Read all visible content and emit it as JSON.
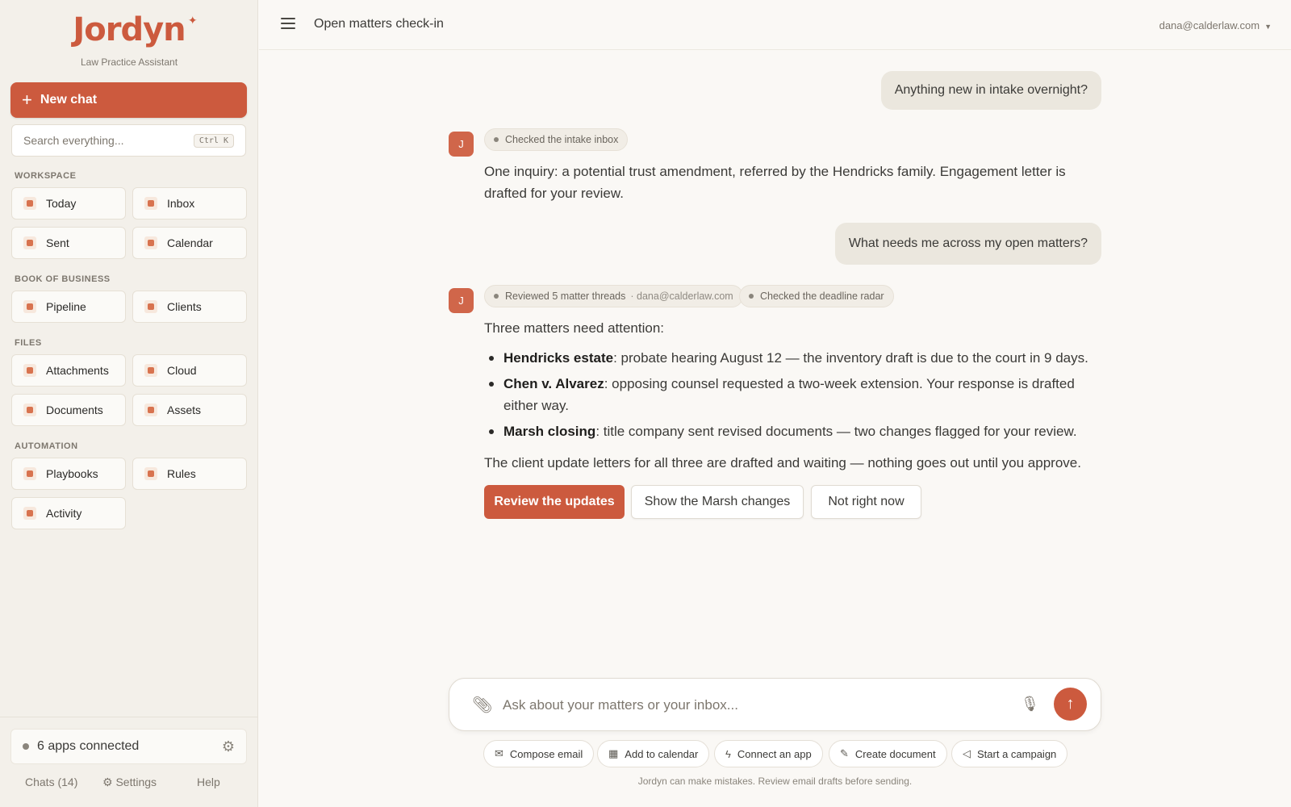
{
  "sidebar": {
    "logo": "Jordyn",
    "tagline": "Law Practice Assistant",
    "new_chat_label": "New chat",
    "search_placeholder": "Search everything...",
    "search_shortcut": "Ctrl K",
    "sections": {
      "workspace": "WORKSPACE",
      "book": "BOOK OF BUSINESS",
      "files": "FILES",
      "automation": "AUTOMATION"
    },
    "items": {
      "today": "Today",
      "inbox": "Inbox",
      "sent": "Sent",
      "calendar": "Calendar",
      "pipeline": "Pipeline",
      "clients": "Clients",
      "attachments": "Attachments",
      "cloud": "Cloud",
      "documents": "Documents",
      "assets": "Assets",
      "playbooks": "Playbooks",
      "rules": "Rules",
      "activity": "Activity"
    },
    "apps_connected": "6 apps connected",
    "footer": {
      "chats": "Chats (14)",
      "settings": "Settings",
      "help": "Help"
    }
  },
  "header": {
    "title": "Open matters check-in",
    "account": "dana@calderlaw.com"
  },
  "conversation": {
    "user_msg_1": "Anything new in intake overnight?",
    "avatar": "J",
    "chip_1": "Checked the intake inbox",
    "reply_1": "One inquiry: a potential trust amendment, referred by the Hendricks family. Engagement letter is drafted for your review.",
    "user_msg_2": "What needs me across my open matters?",
    "chip_2": "Reviewed 5 matter threads",
    "chip_2_sub": "· dana@calderlaw.com",
    "chip_3": "Checked the deadline radar",
    "reply_2_intro": "Three matters need attention:",
    "bullets": [
      {
        "title": "Hendricks estate",
        "text": ": probate hearing August 12 — the inventory draft is due to the court in 9 days."
      },
      {
        "title": "Chen v. Alvarez",
        "text": ": opposing counsel requested a two-week extension. Your response is drafted either way."
      },
      {
        "title": "Marsh closing",
        "text": ": title company sent revised documents — two changes flagged for your review."
      }
    ],
    "reply_2_outro": "The client update letters for all three are drafted and waiting — nothing goes out until you approve.",
    "actions": {
      "primary": "Review the updates",
      "secondary_1": "Show the Marsh changes",
      "secondary_2": "Not right now"
    }
  },
  "composer": {
    "placeholder": "Ask about your matters or your inbox...",
    "quick_actions": {
      "compose": "Compose email",
      "calendar": "Add to calendar",
      "connect": "Connect an app",
      "document": "Create document",
      "campaign": "Start a campaign"
    },
    "disclaimer": "Jordyn can make mistakes. Review email drafts before sending."
  },
  "colors": {
    "accent": "#cc5a3e",
    "sidebar_bg": "#f3f0ea",
    "page_bg": "#faf8f5",
    "user_bubble": "#ebe7de"
  }
}
